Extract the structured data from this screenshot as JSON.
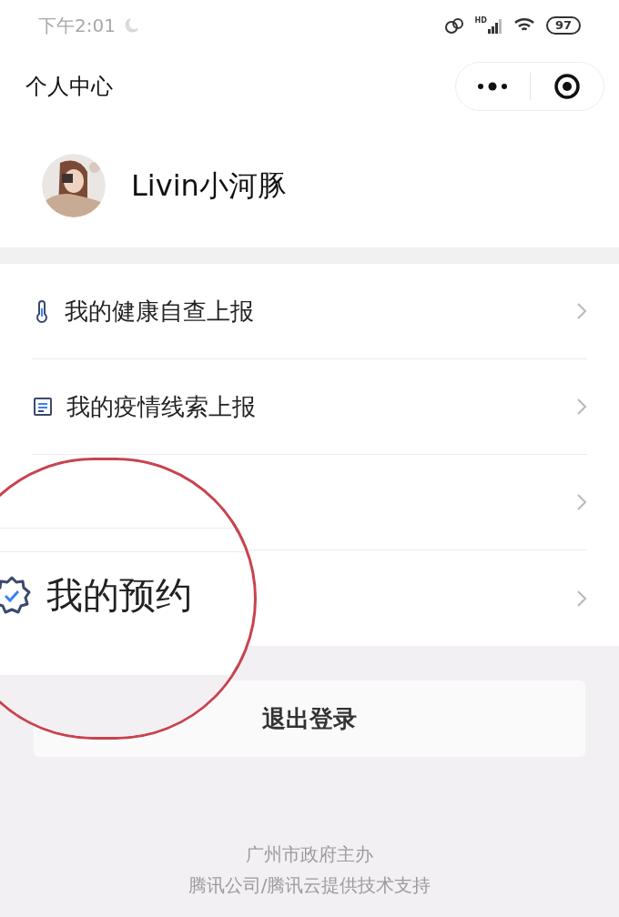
{
  "status_bar": {
    "time": "下午2:01",
    "battery": "97",
    "network": "HD"
  },
  "nav": {
    "title": "个人中心"
  },
  "profile": {
    "name": "Livin小河豚"
  },
  "menu": [
    {
      "kind": "thermometer",
      "label": "我的健康自查上报"
    },
    {
      "kind": "document",
      "label": "我的疫情线索上报"
    },
    {
      "kind": "hidden"
    },
    {
      "kind": "hidden"
    }
  ],
  "magnifier": {
    "label": "我的预约"
  },
  "logout_button": "退出登录",
  "footer": [
    "广州市政府主办",
    "腾讯公司/腾讯云提供技术支持"
  ]
}
